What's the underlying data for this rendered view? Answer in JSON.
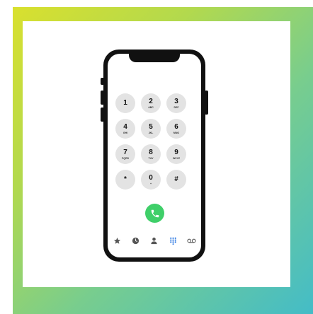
{
  "keypad": {
    "keys": [
      {
        "digit": "1",
        "letters": ""
      },
      {
        "digit": "2",
        "letters": "ABC"
      },
      {
        "digit": "3",
        "letters": "DEF"
      },
      {
        "digit": "4",
        "letters": "GHI"
      },
      {
        "digit": "5",
        "letters": "JKL"
      },
      {
        "digit": "6",
        "letters": "MNO"
      },
      {
        "digit": "7",
        "letters": "PQRS"
      },
      {
        "digit": "8",
        "letters": "TUV"
      },
      {
        "digit": "9",
        "letters": "WXYZ"
      },
      {
        "digit": "*",
        "letters": ""
      },
      {
        "digit": "0",
        "letters": "+"
      },
      {
        "digit": "#",
        "letters": ""
      }
    ]
  },
  "tabbar": {
    "items": [
      {
        "icon": "star-icon",
        "active": false
      },
      {
        "icon": "clock-icon",
        "active": false
      },
      {
        "icon": "person-icon",
        "active": false
      },
      {
        "icon": "keypad-icon",
        "active": true
      },
      {
        "icon": "voicemail-icon",
        "active": false
      }
    ]
  },
  "call_button": {
    "icon": "phone-icon"
  },
  "colors": {
    "frame_gradient": [
      "#d9e02e",
      "#78cd8e",
      "#44bcc7"
    ],
    "call_green": "#3fcf69",
    "active_tab_blue": "#1e6fe0",
    "key_gray": "#e3e3e3"
  }
}
